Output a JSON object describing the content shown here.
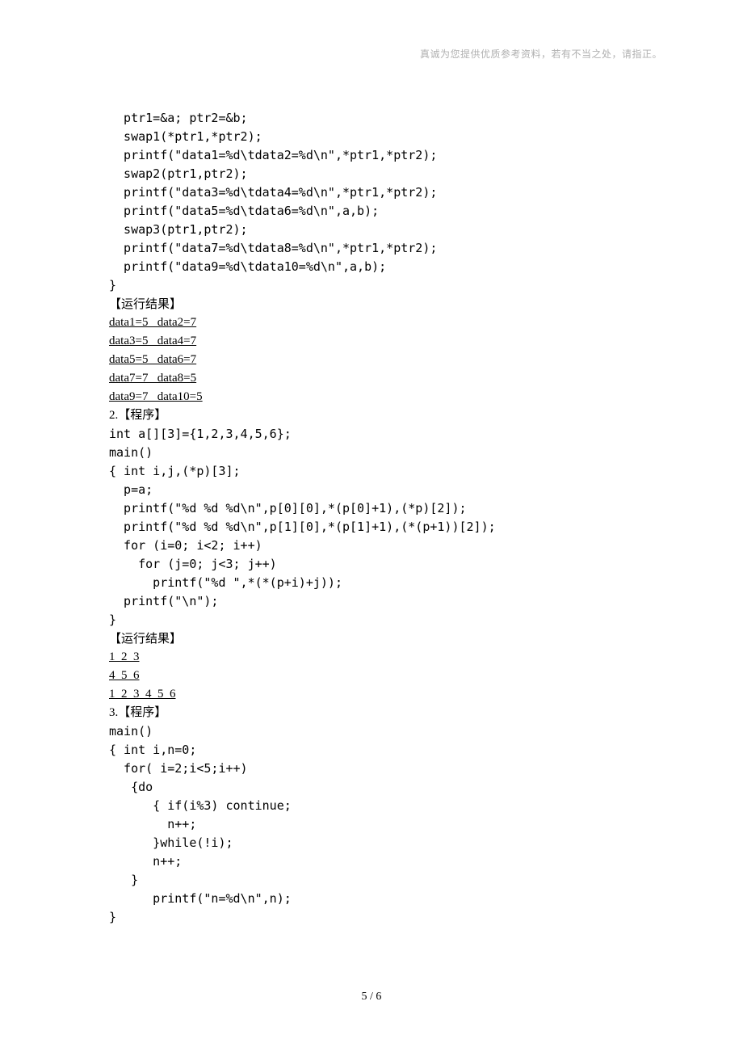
{
  "header_note": "真诚为您提供优质参考资料，若有不当之处，请指正。",
  "lines": [
    {
      "class": "line",
      "text": "  ptr1=&a; ptr2=&b;"
    },
    {
      "class": "line",
      "text": "  swap1(*ptr1,*ptr2);"
    },
    {
      "class": "line",
      "text": "  printf(\"data1=%d\\tdata2=%d\\n\",*ptr1,*ptr2);"
    },
    {
      "class": "line",
      "text": "  swap2(ptr1,ptr2);"
    },
    {
      "class": "line",
      "text": "  printf(\"data3=%d\\tdata4=%d\\n\",*ptr1,*ptr2);"
    },
    {
      "class": "line",
      "text": "  printf(\"data5=%d\\tdata6=%d\\n\",a,b);"
    },
    {
      "class": "line",
      "text": "  swap3(ptr1,ptr2);"
    },
    {
      "class": "line",
      "text": "  printf(\"data7=%d\\tdata8=%d\\n\",*ptr1,*ptr2);"
    },
    {
      "class": "line",
      "text": "  printf(\"data9=%d\\tdata10=%d\\n\",a,b);"
    },
    {
      "class": "line",
      "text": "}"
    },
    {
      "class": "line",
      "text": "【运行结果】"
    },
    {
      "class": "line underline",
      "text": "data1=5   data2=7"
    },
    {
      "class": "line underline",
      "text": "data3=5   data4=7"
    },
    {
      "class": "line underline",
      "text": "data5=5   data6=7"
    },
    {
      "class": "line underline",
      "text": "data7=7   data8=5"
    },
    {
      "class": "line underline",
      "text": "data9=7   data10=5"
    },
    {
      "class": "line serif",
      "text": "2.【程序】"
    },
    {
      "class": "line",
      "text": "int a[][3]={1,2,3,4,5,6};"
    },
    {
      "class": "line",
      "text": "main()"
    },
    {
      "class": "line",
      "text": "{ int i,j,(*p)[3];"
    },
    {
      "class": "line",
      "text": "  p=a;"
    },
    {
      "class": "line",
      "text": "  printf(\"%d %d %d\\n\",p[0][0],*(p[0]+1),(*p)[2]);"
    },
    {
      "class": "line",
      "text": "  printf(\"%d %d %d\\n\",p[1][0],*(p[1]+1),(*(p+1))[2]);"
    },
    {
      "class": "line",
      "text": "  for (i=0; i<2; i++)"
    },
    {
      "class": "line",
      "text": "    for (j=0; j<3; j++)"
    },
    {
      "class": "line",
      "text": "      printf(\"%d \",*(*(p+i)+j));"
    },
    {
      "class": "line",
      "text": "  printf(\"\\n\");"
    },
    {
      "class": "line",
      "text": "}"
    },
    {
      "class": "line",
      "text": "【运行结果】"
    },
    {
      "class": "line underline",
      "text": "1  2  3"
    },
    {
      "class": "line underline",
      "text": "4  5  6"
    },
    {
      "class": "line underline",
      "text": "1  2  3  4  5  6"
    },
    {
      "class": "line serif",
      "text": "3.【程序】"
    },
    {
      "class": "line",
      "text": "main()"
    },
    {
      "class": "line",
      "text": "{ int i,n=0;"
    },
    {
      "class": "line",
      "text": "  for( i=2;i<5;i++)"
    },
    {
      "class": "line",
      "text": "   {do"
    },
    {
      "class": "line",
      "text": "      { if(i%3) continue;"
    },
    {
      "class": "line",
      "text": "        n++;"
    },
    {
      "class": "line",
      "text": "      }while(!i);"
    },
    {
      "class": "line",
      "text": "      n++;"
    },
    {
      "class": "line",
      "text": "   }"
    },
    {
      "class": "line",
      "text": "      printf(\"n=%d\\n\",n);"
    },
    {
      "class": "line",
      "text": "}"
    }
  ],
  "page_number": "5 / 6"
}
